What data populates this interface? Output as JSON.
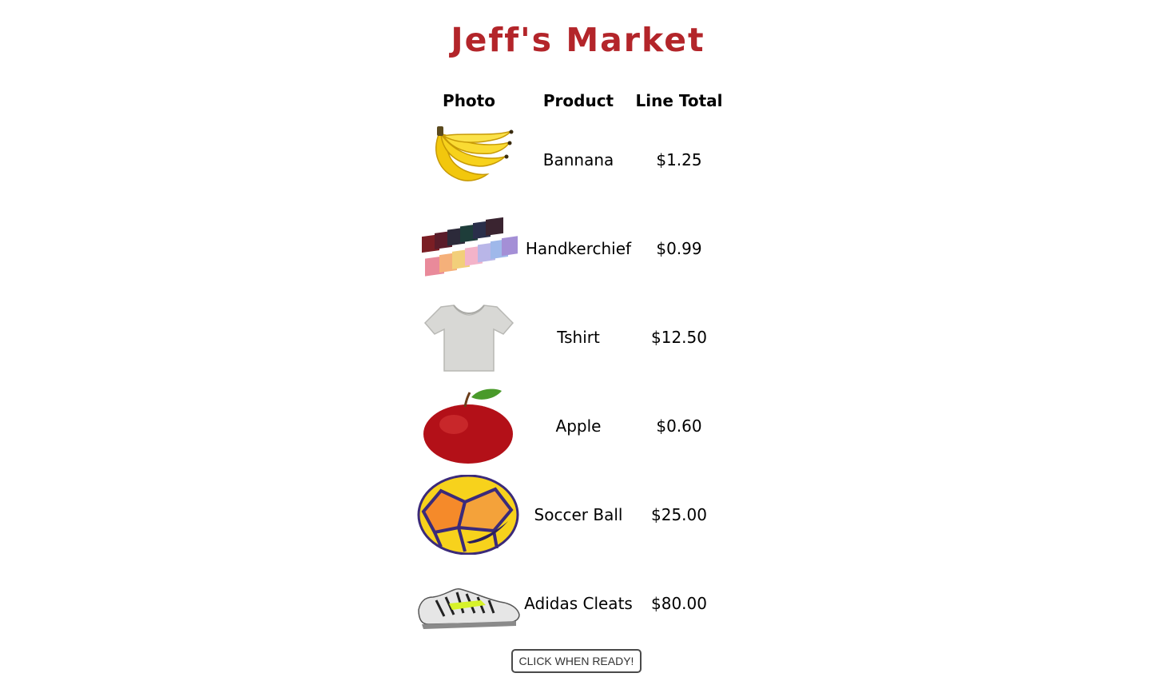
{
  "page": {
    "title": "Jeff's Market"
  },
  "table": {
    "headers": {
      "photo": "Photo",
      "product": "Product",
      "line_total": "Line Total"
    },
    "rows": [
      {
        "photo_icon": "banana-photo",
        "product": "Bannana",
        "line_total": "$1.25"
      },
      {
        "photo_icon": "handkerchief-photo",
        "product": "Handkerchief",
        "line_total": "$0.99"
      },
      {
        "photo_icon": "tshirt-photo",
        "product": "Tshirt",
        "line_total": "$12.50"
      },
      {
        "photo_icon": "apple-photo",
        "product": "Apple",
        "line_total": "$0.60"
      },
      {
        "photo_icon": "soccer-ball-photo",
        "product": "Soccer Ball",
        "line_total": "$25.00"
      },
      {
        "photo_icon": "cleats-photo",
        "product": "Adidas Cleats",
        "line_total": "$80.00"
      }
    ]
  },
  "button": {
    "label": "CLICK WHEN READY!"
  },
  "colors": {
    "title": "#b3252a",
    "button_border": "#4a4a4a"
  }
}
